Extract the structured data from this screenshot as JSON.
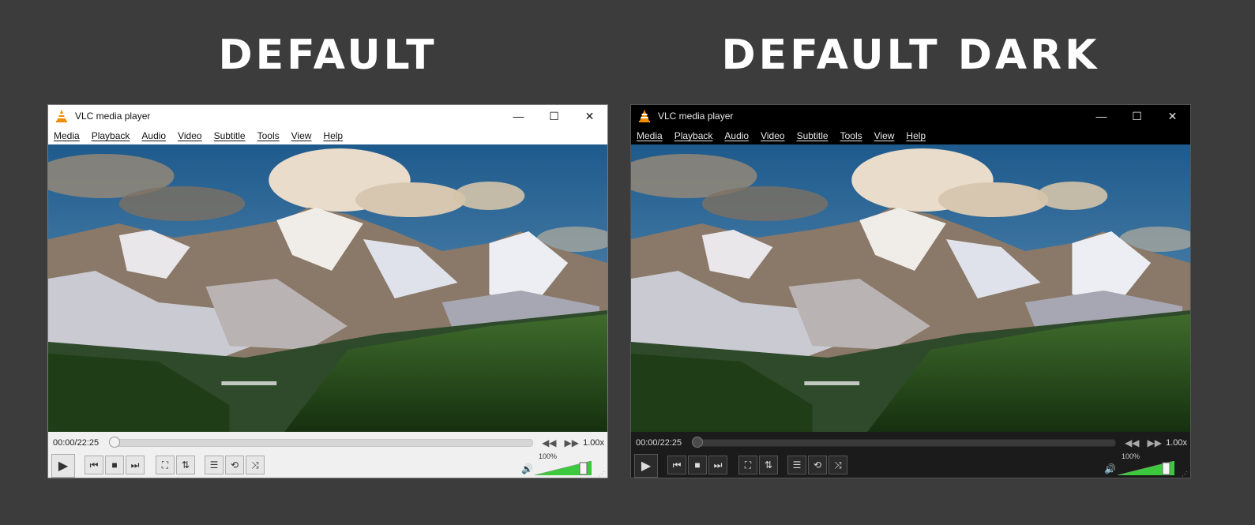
{
  "headings": {
    "left": "DEFAULT",
    "right": "DEFAULT DARK"
  },
  "window": {
    "title": "VLC media player",
    "controls": {
      "minimize": "—",
      "maximize": "☐",
      "close": "✕"
    }
  },
  "menu": [
    "Media",
    "Playback",
    "Audio",
    "Video",
    "Subtitle",
    "Tools",
    "View",
    "Help"
  ],
  "seek": {
    "time": "00:00/22:25",
    "position": 0,
    "rate": "1.00x"
  },
  "buttons": {
    "play": "▶",
    "prev": "⏮",
    "stop": "■",
    "next": "⏭",
    "fullscreen": "⛶",
    "extended": "⇅",
    "playlist": "☰",
    "loop": "⟲",
    "shuffle": "⤨",
    "slower": "◀◀",
    "faster": "▶▶"
  },
  "volume": {
    "label": "100%",
    "level": 1.0,
    "icon": "speaker-icon"
  },
  "colors": {
    "background": "#3c3c3c",
    "volume_fill": "#3dc93d",
    "cone_orange": "#f08c00"
  }
}
